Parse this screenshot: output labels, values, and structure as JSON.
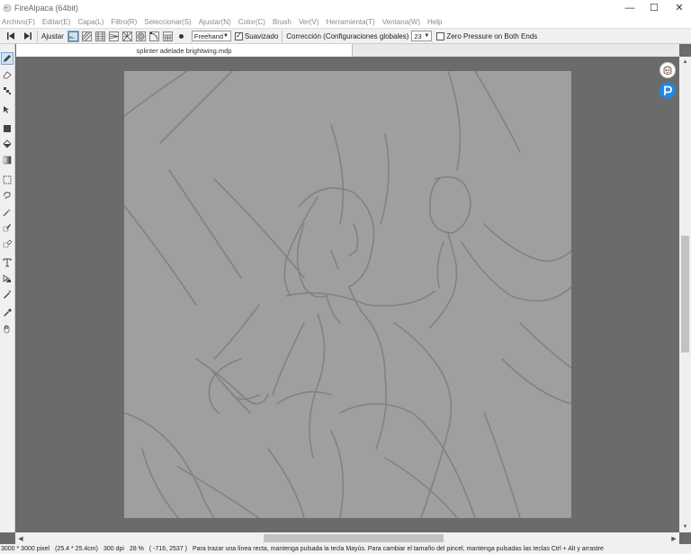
{
  "window": {
    "title": "FireAlpaca (64bit)",
    "controls": {
      "minimize": "—",
      "maximize": "☐",
      "close": "✕"
    }
  },
  "menu": [
    "Archivo(F)",
    "Editar(E)",
    "Capa(L)",
    "Filtro(R)",
    "Seleccionar(S)",
    "Ajustar(N)",
    "Color(C)",
    "Brush",
    "Ver(V)",
    "Herramienta(T)",
    "Ventana(W)",
    "Help"
  ],
  "toolbar": {
    "ajustar_label": "Ajustar",
    "brush_mode": "Freehand",
    "suavizado_label": "Suavizado",
    "suavizado_checked": true,
    "correccion_label": "Corrección (Configuraciones globales)",
    "correccion_value": "23",
    "zero_pressure_label": "Zero Pressure on Both Ends",
    "zero_pressure_checked": false
  },
  "document_tab": {
    "label": "splinter adelade brightwing.mdp"
  },
  "tools": [
    "pen-tool",
    "eraser-tool",
    "dot-tool",
    "move-tool",
    "fill-rect-tool",
    "bucket-tool",
    "gradient-tool",
    "select-rect-tool",
    "lasso-tool",
    "magic-wand-tool",
    "select-pen-tool",
    "select-eraser-tool",
    "text-tool",
    "operation-tool",
    "divide-tool",
    "eyedropper-tool",
    "hand-tool"
  ],
  "status": {
    "size": "3000 * 3000 pixel",
    "size_cm": "(25.4 * 25.4cm)",
    "dpi": "300 dpi",
    "zoom": "28 %",
    "cursor": "( -716, 2537 )",
    "hint": "Para trazar una línea recta, mantenga pulsada la tecla Mayús. Para cambiar el tamaño del pincel, mantenga pulsadas las teclas Ctrl + Alt y arrastre"
  },
  "colors": {
    "accent": "#1e88e5",
    "canvas": "#9f9f9f",
    "workspace": "#6b6b6b"
  }
}
